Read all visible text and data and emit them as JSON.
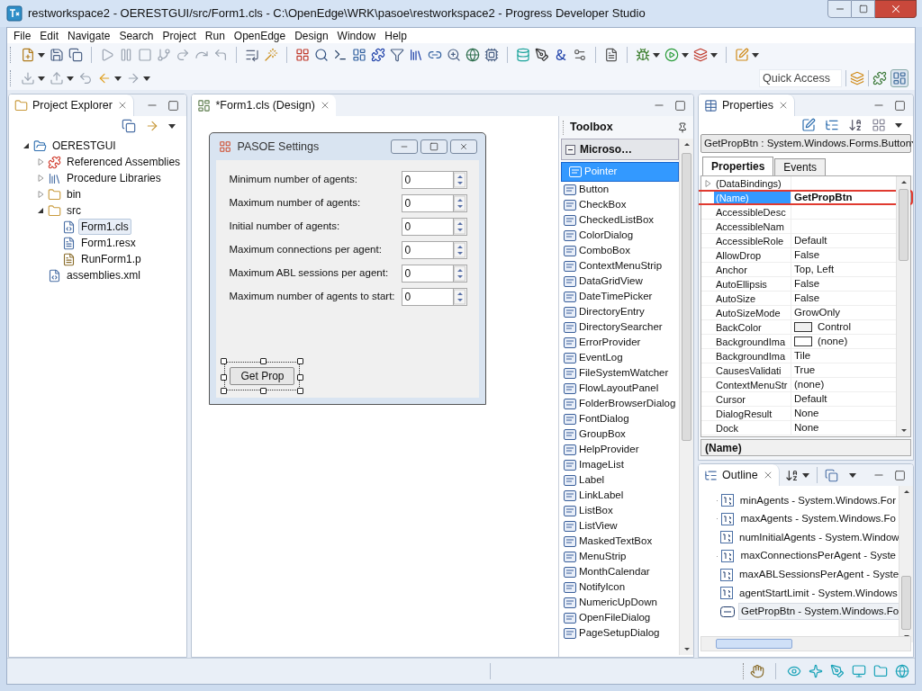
{
  "window": {
    "title": "restworkspace2 - OERESTGUI/src/Form1.cls - C:\\OpenEdge\\WRK\\pasoe\\restworkspace2 - Progress Developer Studio"
  },
  "menu": [
    "File",
    "Edit",
    "Navigate",
    "Search",
    "Project",
    "Run",
    "OpenEdge",
    "Design",
    "Window",
    "Help"
  ],
  "quick_access": {
    "placeholder": "Quick Access"
  },
  "project_explorer": {
    "title": "Project Explorer",
    "tree": [
      {
        "label": "OERESTGUI",
        "kind": "project",
        "expanded": true,
        "selected": false,
        "children": [
          {
            "label": "Referenced Assemblies",
            "kind": "assemblies",
            "expanded": false,
            "selected": false
          },
          {
            "label": "Procedure Libraries",
            "kind": "libraries",
            "expanded": false,
            "selected": false
          },
          {
            "label": "bin",
            "kind": "folder",
            "expanded": false,
            "selected": false
          },
          {
            "label": "src",
            "kind": "folder",
            "expanded": true,
            "selected": false,
            "children": [
              {
                "label": "Form1.cls",
                "kind": "class",
                "selected": true
              },
              {
                "label": "Form1.resx",
                "kind": "resx",
                "selected": false
              },
              {
                "label": "RunForm1.p",
                "kind": "procedure",
                "selected": false
              }
            ]
          },
          {
            "label": "assemblies.xml",
            "kind": "xml",
            "selected": false
          }
        ]
      }
    ]
  },
  "editor": {
    "tab": "*Form1.cls (Design)",
    "form": {
      "title": "PASOE Settings",
      "fields": [
        {
          "label": "Minimum number of agents:",
          "value": "0"
        },
        {
          "label": "Maximum number of agents:",
          "value": "0"
        },
        {
          "label": "Initial number of agents:",
          "value": "0"
        },
        {
          "label": "Maximum connections per agent:",
          "value": "0"
        },
        {
          "label": "Maximum ABL sessions per agent:",
          "value": "0"
        },
        {
          "label": "Maximum number of agents to start:",
          "value": "0"
        }
      ],
      "button": {
        "label": "Get Prop",
        "selected": true
      }
    }
  },
  "toolbox": {
    "title": "Toolbox",
    "group": {
      "label": "Microso…",
      "expanded": true
    },
    "items": [
      {
        "label": "Pointer",
        "selected": true
      },
      {
        "label": "Button",
        "selected": false
      },
      {
        "label": "CheckBox",
        "selected": false
      },
      {
        "label": "CheckedListBox",
        "selected": false
      },
      {
        "label": "ColorDialog",
        "selected": false
      },
      {
        "label": "ComboBox",
        "selected": false
      },
      {
        "label": "ContextMenuStrip",
        "selected": false
      },
      {
        "label": "DataGridView",
        "selected": false
      },
      {
        "label": "DateTimePicker",
        "selected": false
      },
      {
        "label": "DirectoryEntry",
        "selected": false
      },
      {
        "label": "DirectorySearcher",
        "selected": false
      },
      {
        "label": "ErrorProvider",
        "selected": false
      },
      {
        "label": "EventLog",
        "selected": false
      },
      {
        "label": "FileSystemWatcher",
        "selected": false
      },
      {
        "label": "FlowLayoutPanel",
        "selected": false
      },
      {
        "label": "FolderBrowserDialog",
        "selected": false
      },
      {
        "label": "FontDialog",
        "selected": false
      },
      {
        "label": "GroupBox",
        "selected": false
      },
      {
        "label": "HelpProvider",
        "selected": false
      },
      {
        "label": "ImageList",
        "selected": false
      },
      {
        "label": "Label",
        "selected": false
      },
      {
        "label": "LinkLabel",
        "selected": false
      },
      {
        "label": "ListBox",
        "selected": false
      },
      {
        "label": "ListView",
        "selected": false
      },
      {
        "label": "MaskedTextBox",
        "selected": false
      },
      {
        "label": "MenuStrip",
        "selected": false
      },
      {
        "label": "MonthCalendar",
        "selected": false
      },
      {
        "label": "NotifyIcon",
        "selected": false
      },
      {
        "label": "NumericUpDown",
        "selected": false
      },
      {
        "label": "OpenFileDialog",
        "selected": false
      },
      {
        "label": "PageSetupDialog",
        "selected": false
      }
    ]
  },
  "properties": {
    "title": "Properties",
    "object": "GetPropBtn : System.Windows.Forms.Button",
    "tabs": [
      {
        "label": "Properties",
        "selected": true
      },
      {
        "label": "Events",
        "selected": false
      }
    ],
    "rows": [
      {
        "name": "(DataBindings)",
        "expanded": false,
        "selected": false
      },
      {
        "name": "(Name)",
        "value": "GetPropBtn",
        "selected": true,
        "highlighted": true
      },
      {
        "name": "AccessibleDesc",
        "selected": false
      },
      {
        "name": "AccessibleNam",
        "selected": false
      },
      {
        "name": "AccessibleRole",
        "value": "Default",
        "selected": false
      },
      {
        "name": "AllowDrop",
        "value": "False",
        "selected": false
      },
      {
        "name": "Anchor",
        "value": "Top, Left",
        "selected": false
      },
      {
        "name": "AutoEllipsis",
        "value": "False",
        "selected": false
      },
      {
        "name": "AutoSize",
        "value": "False",
        "selected": false
      },
      {
        "name": "AutoSizeMode",
        "value": "GrowOnly",
        "selected": false
      },
      {
        "name": "BackColor",
        "value": "Control",
        "color": "#f0f0f0",
        "selected": false
      },
      {
        "name": "BackgroundIma",
        "value": "(none)",
        "color": "#ffffff",
        "selected": false
      },
      {
        "name": "BackgroundIma",
        "value": "Tile",
        "selected": false
      },
      {
        "name": "CausesValidati",
        "value": "True",
        "selected": false
      },
      {
        "name": "ContextMenuStr",
        "value": "(none)",
        "selected": false
      },
      {
        "name": "Cursor",
        "value": "Default",
        "selected": false
      },
      {
        "name": "DialogResult",
        "value": "None",
        "selected": false
      },
      {
        "name": "Dock",
        "value": "None",
        "selected": false
      }
    ],
    "description": "(Name)"
  },
  "outline": {
    "title": "Outline",
    "items": [
      {
        "label": "minAgents - System.Windows.For",
        "kind": "numeric",
        "selected": false
      },
      {
        "label": "maxAgents - System.Windows.Fo",
        "kind": "numeric",
        "selected": false
      },
      {
        "label": "numInitialAgents - System.Window",
        "kind": "numeric",
        "selected": false
      },
      {
        "label": "maxConnectionsPerAgent - Syste",
        "kind": "numeric",
        "selected": false
      },
      {
        "label": "maxABLSessionsPerAgent - Syste",
        "kind": "numeric",
        "selected": false
      },
      {
        "label": "agentStartLimit - System.Windows",
        "kind": "numeric",
        "selected": false
      },
      {
        "label": "GetPropBtn - System.Windows.Fo",
        "kind": "button",
        "selected": true
      }
    ]
  }
}
